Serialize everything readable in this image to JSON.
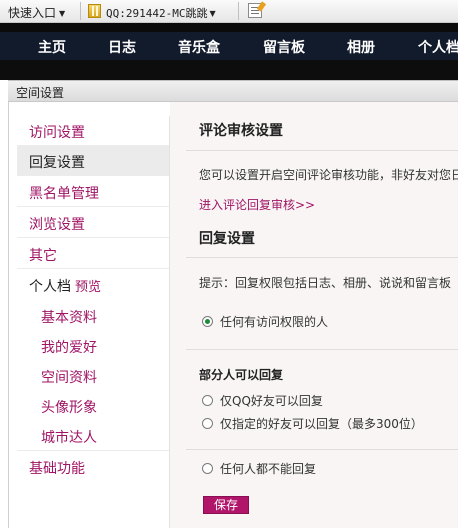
{
  "toolbar": {
    "quick_entry": "快速入口",
    "qq_label": "QQ:291442-MC跳跳"
  },
  "nav": [
    "主页",
    "日志",
    "音乐盒",
    "留言板",
    "相册",
    "个人档"
  ],
  "panel": {
    "title": "空间设置"
  },
  "sidebar": {
    "items": [
      {
        "label": "访问设置"
      },
      {
        "label": "回复设置"
      },
      {
        "label": "黑名单管理"
      },
      {
        "label": "浏览设置"
      },
      {
        "label": "其它"
      }
    ],
    "profile": {
      "label": "个人档",
      "preview": "预览"
    },
    "sub_items": [
      {
        "label": "基本资料"
      },
      {
        "label": "我的爱好"
      },
      {
        "label": "空间资料"
      },
      {
        "label": "头像形象"
      },
      {
        "label": "城市达人"
      }
    ],
    "basic": "基础功能"
  },
  "content": {
    "review_title": "评论审核设置",
    "review_desc": "您可以设置开启空间评论审核功能，非好友对您日",
    "review_link": "进入评论回复审核>>",
    "reply_title": "回复设置",
    "tip": "提示：回复权限包括日志、相册、说说和留言板",
    "option_anyone": "任何有访问权限的人",
    "partial_title": "部分人可以回复",
    "option_qq_friends": "仅QQ好友可以回复",
    "option_specified": "仅指定的好友可以回复（最多300位）",
    "option_none": "任何人都不能回复",
    "save": "保存"
  }
}
